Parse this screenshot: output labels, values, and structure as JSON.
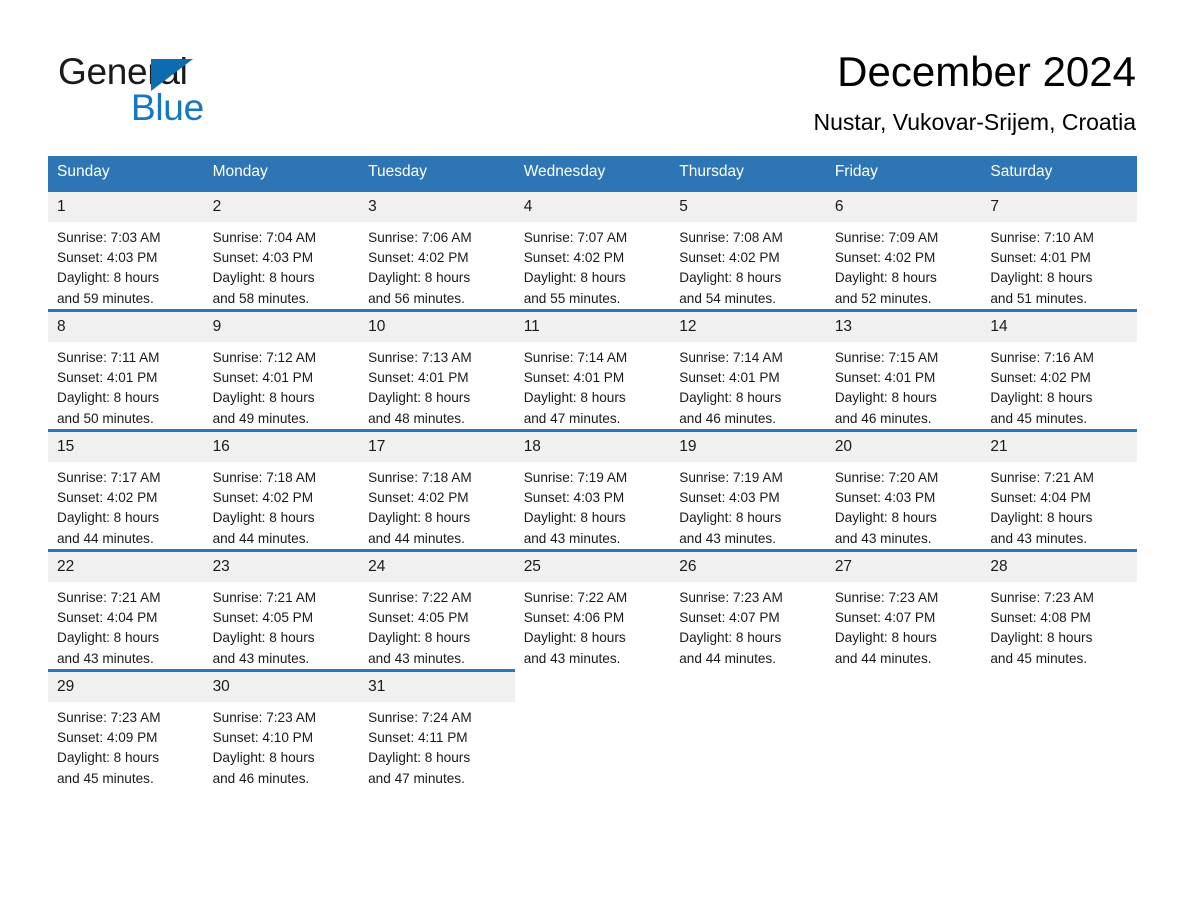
{
  "brand": {
    "name_part1": "General",
    "name_part2": "Blue",
    "triangle_color": "#0d6cb0",
    "blue_color": "#1277c4"
  },
  "header": {
    "title": "December 2024",
    "subtitle": "Nustar, Vukovar-Srijem, Croatia"
  },
  "theme": {
    "header_blue": "#2e75b6",
    "daynum_band": "#f0f0f0",
    "text": "#1a1a1a"
  },
  "calendar": {
    "day_headers": [
      "Sunday",
      "Monday",
      "Tuesday",
      "Wednesday",
      "Thursday",
      "Friday",
      "Saturday"
    ],
    "weeks": [
      [
        {
          "day": "1",
          "sunrise": "Sunrise: 7:03 AM",
          "sunset": "Sunset: 4:03 PM",
          "daylight1": "Daylight: 8 hours",
          "daylight2": "and 59 minutes."
        },
        {
          "day": "2",
          "sunrise": "Sunrise: 7:04 AM",
          "sunset": "Sunset: 4:03 PM",
          "daylight1": "Daylight: 8 hours",
          "daylight2": "and 58 minutes."
        },
        {
          "day": "3",
          "sunrise": "Sunrise: 7:06 AM",
          "sunset": "Sunset: 4:02 PM",
          "daylight1": "Daylight: 8 hours",
          "daylight2": "and 56 minutes."
        },
        {
          "day": "4",
          "sunrise": "Sunrise: 7:07 AM",
          "sunset": "Sunset: 4:02 PM",
          "daylight1": "Daylight: 8 hours",
          "daylight2": "and 55 minutes."
        },
        {
          "day": "5",
          "sunrise": "Sunrise: 7:08 AM",
          "sunset": "Sunset: 4:02 PM",
          "daylight1": "Daylight: 8 hours",
          "daylight2": "and 54 minutes."
        },
        {
          "day": "6",
          "sunrise": "Sunrise: 7:09 AM",
          "sunset": "Sunset: 4:02 PM",
          "daylight1": "Daylight: 8 hours",
          "daylight2": "and 52 minutes."
        },
        {
          "day": "7",
          "sunrise": "Sunrise: 7:10 AM",
          "sunset": "Sunset: 4:01 PM",
          "daylight1": "Daylight: 8 hours",
          "daylight2": "and 51 minutes."
        }
      ],
      [
        {
          "day": "8",
          "sunrise": "Sunrise: 7:11 AM",
          "sunset": "Sunset: 4:01 PM",
          "daylight1": "Daylight: 8 hours",
          "daylight2": "and 50 minutes."
        },
        {
          "day": "9",
          "sunrise": "Sunrise: 7:12 AM",
          "sunset": "Sunset: 4:01 PM",
          "daylight1": "Daylight: 8 hours",
          "daylight2": "and 49 minutes."
        },
        {
          "day": "10",
          "sunrise": "Sunrise: 7:13 AM",
          "sunset": "Sunset: 4:01 PM",
          "daylight1": "Daylight: 8 hours",
          "daylight2": "and 48 minutes."
        },
        {
          "day": "11",
          "sunrise": "Sunrise: 7:14 AM",
          "sunset": "Sunset: 4:01 PM",
          "daylight1": "Daylight: 8 hours",
          "daylight2": "and 47 minutes."
        },
        {
          "day": "12",
          "sunrise": "Sunrise: 7:14 AM",
          "sunset": "Sunset: 4:01 PM",
          "daylight1": "Daylight: 8 hours",
          "daylight2": "and 46 minutes."
        },
        {
          "day": "13",
          "sunrise": "Sunrise: 7:15 AM",
          "sunset": "Sunset: 4:01 PM",
          "daylight1": "Daylight: 8 hours",
          "daylight2": "and 46 minutes."
        },
        {
          "day": "14",
          "sunrise": "Sunrise: 7:16 AM",
          "sunset": "Sunset: 4:02 PM",
          "daylight1": "Daylight: 8 hours",
          "daylight2": "and 45 minutes."
        }
      ],
      [
        {
          "day": "15",
          "sunrise": "Sunrise: 7:17 AM",
          "sunset": "Sunset: 4:02 PM",
          "daylight1": "Daylight: 8 hours",
          "daylight2": "and 44 minutes."
        },
        {
          "day": "16",
          "sunrise": "Sunrise: 7:18 AM",
          "sunset": "Sunset: 4:02 PM",
          "daylight1": "Daylight: 8 hours",
          "daylight2": "and 44 minutes."
        },
        {
          "day": "17",
          "sunrise": "Sunrise: 7:18 AM",
          "sunset": "Sunset: 4:02 PM",
          "daylight1": "Daylight: 8 hours",
          "daylight2": "and 44 minutes."
        },
        {
          "day": "18",
          "sunrise": "Sunrise: 7:19 AM",
          "sunset": "Sunset: 4:03 PM",
          "daylight1": "Daylight: 8 hours",
          "daylight2": "and 43 minutes."
        },
        {
          "day": "19",
          "sunrise": "Sunrise: 7:19 AM",
          "sunset": "Sunset: 4:03 PM",
          "daylight1": "Daylight: 8 hours",
          "daylight2": "and 43 minutes."
        },
        {
          "day": "20",
          "sunrise": "Sunrise: 7:20 AM",
          "sunset": "Sunset: 4:03 PM",
          "daylight1": "Daylight: 8 hours",
          "daylight2": "and 43 minutes."
        },
        {
          "day": "21",
          "sunrise": "Sunrise: 7:21 AM",
          "sunset": "Sunset: 4:04 PM",
          "daylight1": "Daylight: 8 hours",
          "daylight2": "and 43 minutes."
        }
      ],
      [
        {
          "day": "22",
          "sunrise": "Sunrise: 7:21 AM",
          "sunset": "Sunset: 4:04 PM",
          "daylight1": "Daylight: 8 hours",
          "daylight2": "and 43 minutes."
        },
        {
          "day": "23",
          "sunrise": "Sunrise: 7:21 AM",
          "sunset": "Sunset: 4:05 PM",
          "daylight1": "Daylight: 8 hours",
          "daylight2": "and 43 minutes."
        },
        {
          "day": "24",
          "sunrise": "Sunrise: 7:22 AM",
          "sunset": "Sunset: 4:05 PM",
          "daylight1": "Daylight: 8 hours",
          "daylight2": "and 43 minutes."
        },
        {
          "day": "25",
          "sunrise": "Sunrise: 7:22 AM",
          "sunset": "Sunset: 4:06 PM",
          "daylight1": "Daylight: 8 hours",
          "daylight2": "and 43 minutes."
        },
        {
          "day": "26",
          "sunrise": "Sunrise: 7:23 AM",
          "sunset": "Sunset: 4:07 PM",
          "daylight1": "Daylight: 8 hours",
          "daylight2": "and 44 minutes."
        },
        {
          "day": "27",
          "sunrise": "Sunrise: 7:23 AM",
          "sunset": "Sunset: 4:07 PM",
          "daylight1": "Daylight: 8 hours",
          "daylight2": "and 44 minutes."
        },
        {
          "day": "28",
          "sunrise": "Sunrise: 7:23 AM",
          "sunset": "Sunset: 4:08 PM",
          "daylight1": "Daylight: 8 hours",
          "daylight2": "and 45 minutes."
        }
      ],
      [
        {
          "day": "29",
          "sunrise": "Sunrise: 7:23 AM",
          "sunset": "Sunset: 4:09 PM",
          "daylight1": "Daylight: 8 hours",
          "daylight2": "and 45 minutes."
        },
        {
          "day": "30",
          "sunrise": "Sunrise: 7:23 AM",
          "sunset": "Sunset: 4:10 PM",
          "daylight1": "Daylight: 8 hours",
          "daylight2": "and 46 minutes."
        },
        {
          "day": "31",
          "sunrise": "Sunrise: 7:24 AM",
          "sunset": "Sunset: 4:11 PM",
          "daylight1": "Daylight: 8 hours",
          "daylight2": "and 47 minutes."
        },
        {
          "day": "",
          "sunrise": "",
          "sunset": "",
          "daylight1": "",
          "daylight2": ""
        },
        {
          "day": "",
          "sunrise": "",
          "sunset": "",
          "daylight1": "",
          "daylight2": ""
        },
        {
          "day": "",
          "sunrise": "",
          "sunset": "",
          "daylight1": "",
          "daylight2": ""
        },
        {
          "day": "",
          "sunrise": "",
          "sunset": "",
          "daylight1": "",
          "daylight2": ""
        }
      ]
    ]
  }
}
